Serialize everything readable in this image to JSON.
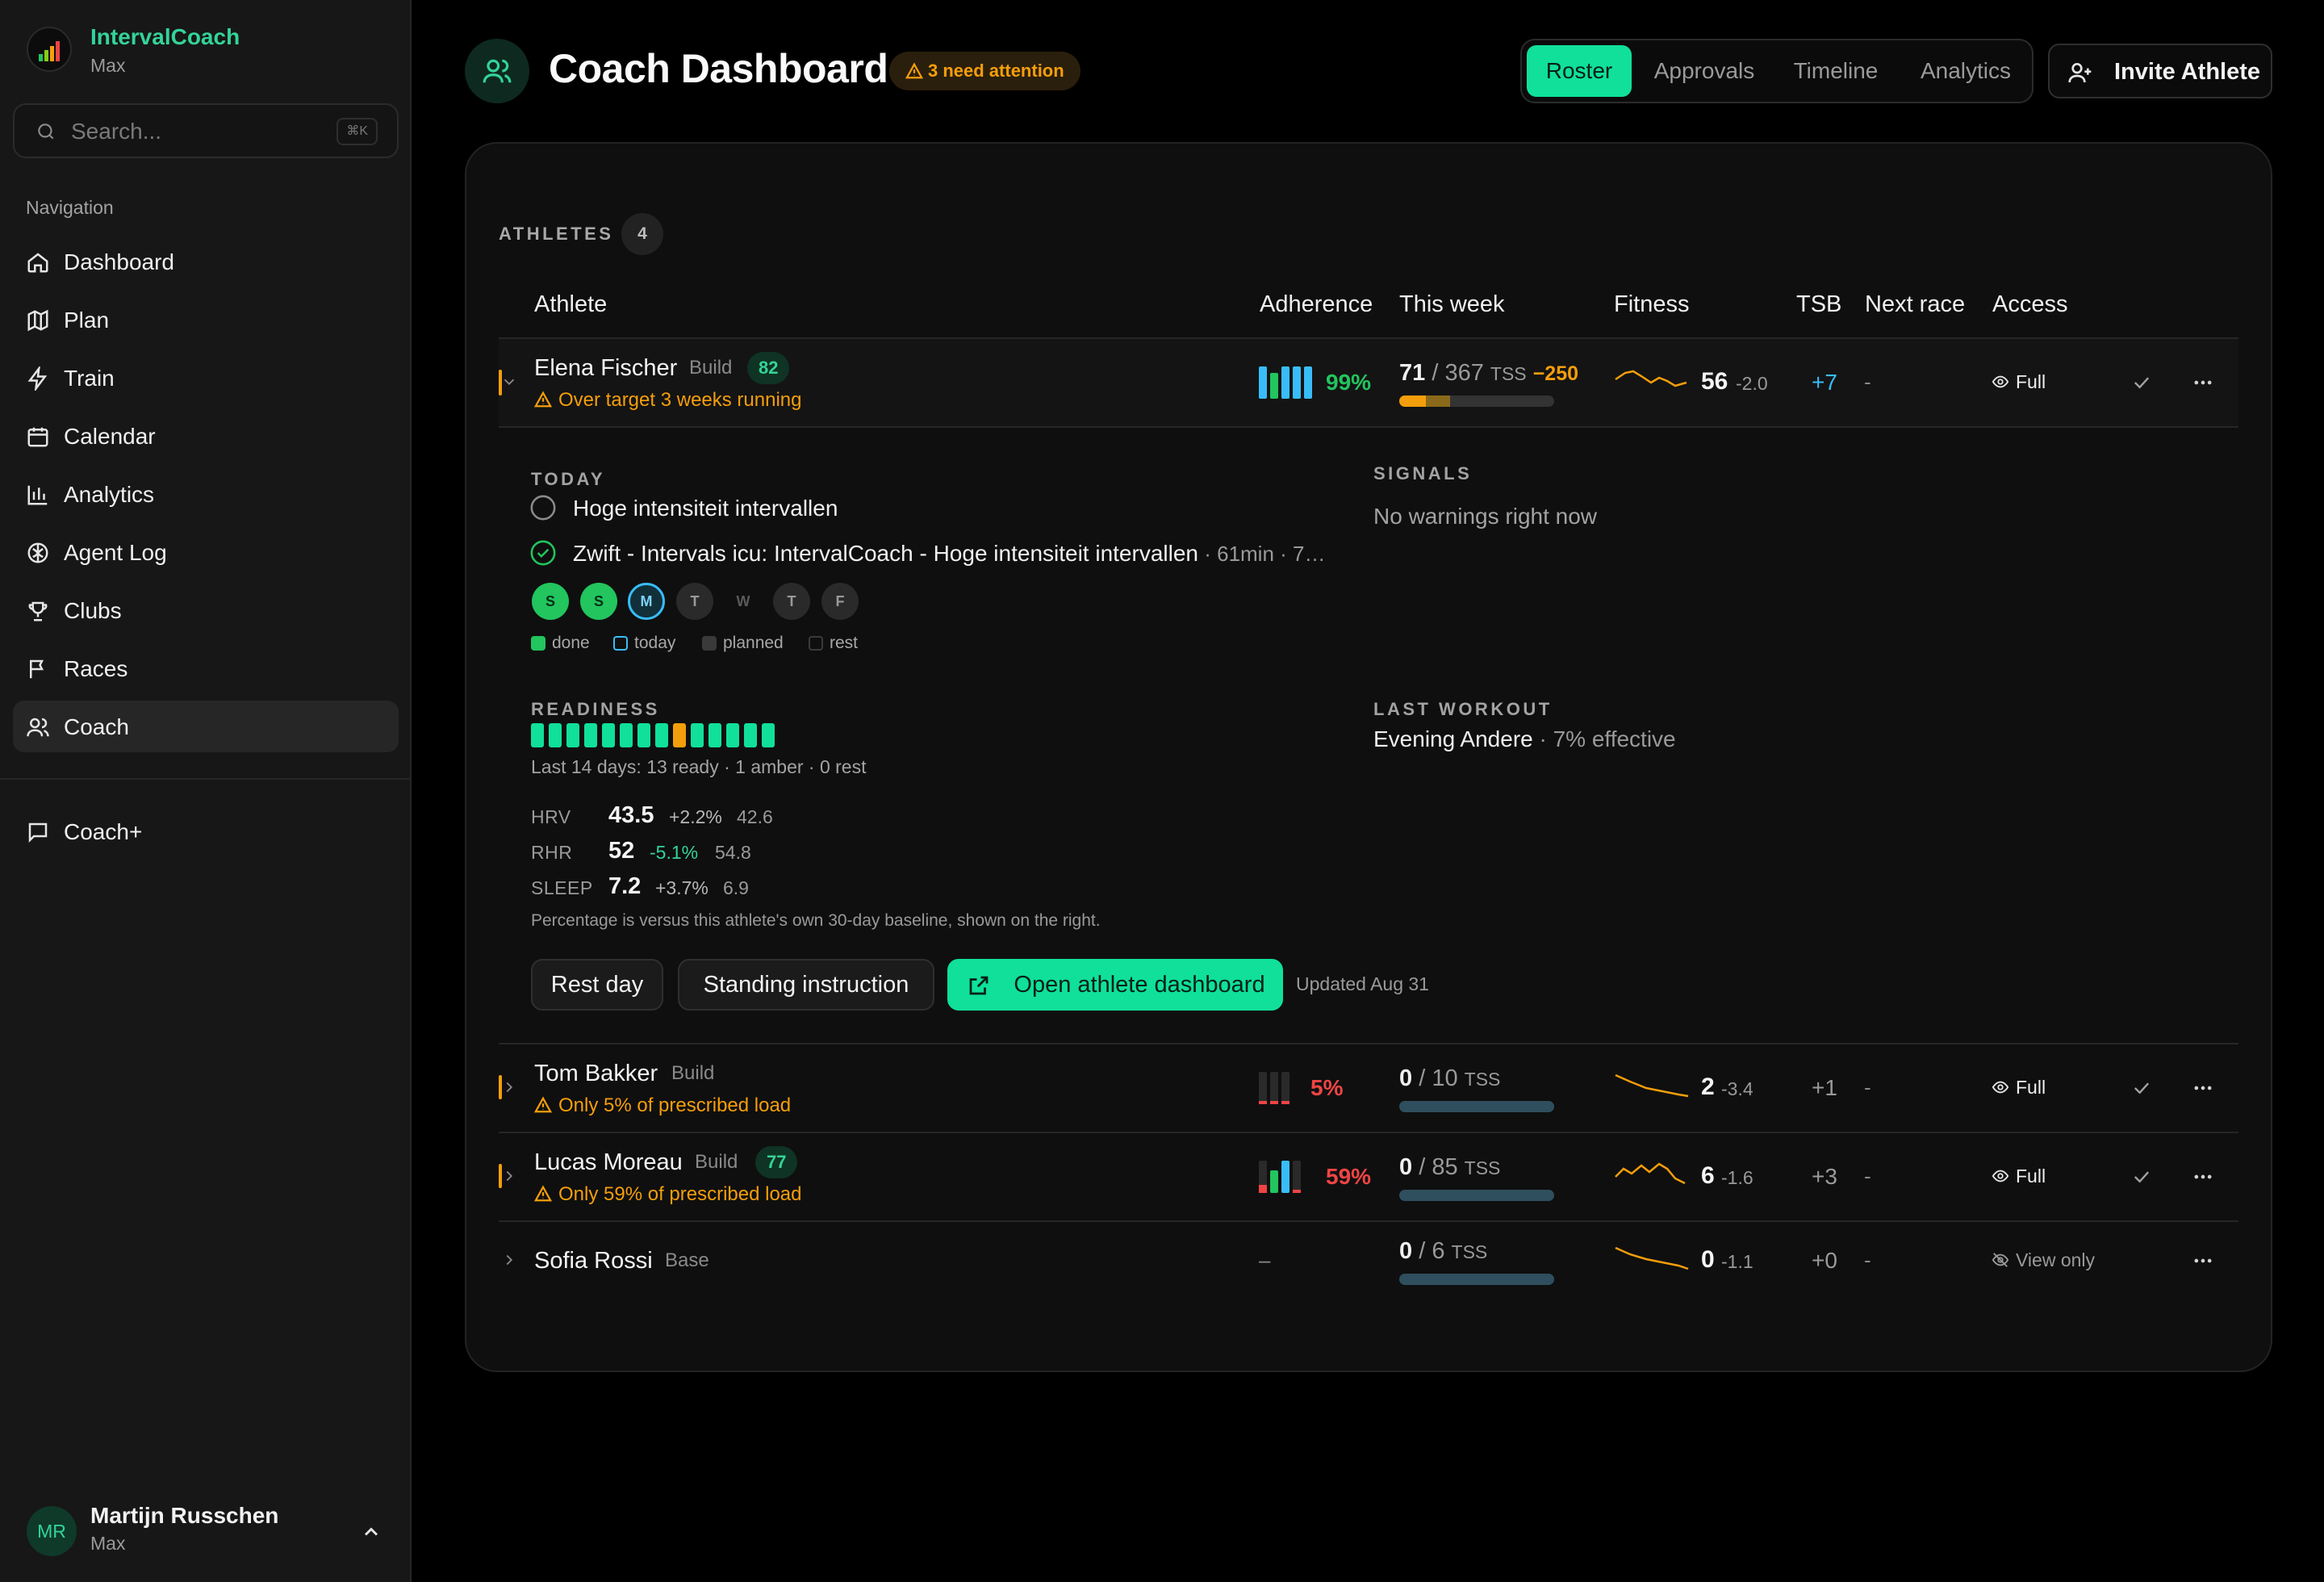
{
  "brand": {
    "name": "IntervalCoach",
    "sub": "Max"
  },
  "search": {
    "placeholder": "Search...",
    "shortcut": "⌘K"
  },
  "nav": {
    "heading": "Navigation",
    "items": [
      {
        "label": "Dashboard",
        "icon": "home-icon"
      },
      {
        "label": "Plan",
        "icon": "map-icon"
      },
      {
        "label": "Train",
        "icon": "bolt-icon"
      },
      {
        "label": "Calendar",
        "icon": "calendar-icon"
      },
      {
        "label": "Analytics",
        "icon": "bar-chart-icon"
      },
      {
        "label": "Agent Log",
        "icon": "brain-icon"
      },
      {
        "label": "Clubs",
        "icon": "trophy-icon"
      },
      {
        "label": "Races",
        "icon": "flag-icon"
      },
      {
        "label": "Coach",
        "icon": "users-icon",
        "active": true
      }
    ],
    "extra": {
      "label": "Coach+",
      "icon": "message-icon"
    }
  },
  "user": {
    "initials": "MR",
    "name": "Martijn Russchen",
    "sub": "Max"
  },
  "header": {
    "title": "Coach Dashboard",
    "attention": "3 need attention",
    "tabs": [
      "Roster",
      "Approvals",
      "Timeline",
      "Analytics"
    ],
    "active_tab": "Roster",
    "invite": "Invite Athlete"
  },
  "roster": {
    "label": "ATHLETES",
    "count": "4",
    "columns": [
      "Athlete",
      "Adherence",
      "This week",
      "Fitness",
      "TSB",
      "Next race",
      "Access"
    ],
    "athletes": [
      {
        "name": "Elena Fischer",
        "phase": "Build",
        "score": "82",
        "warning": "Over target 3 weeks running",
        "adherence": "99%",
        "adherence_fraction": 0.99,
        "tss_done": "71",
        "tss_sep": "/",
        "tss_target": "367",
        "tss_unit": "TSS",
        "tss_delta": "−250",
        "fitness": "56",
        "fitness_delta": "-2.0",
        "tsb": "+7",
        "next_race": "-",
        "access": "Full"
      },
      {
        "name": "Tom Bakker",
        "phase": "Build",
        "warning": "Only 5% of prescribed load",
        "adherence": "5%",
        "adherence_fraction": 0.05,
        "tss_done": "0",
        "tss_sep": "/",
        "tss_target": "10",
        "tss_unit": "TSS",
        "fitness": "2",
        "fitness_delta": "-3.4",
        "tsb": "+1",
        "next_race": "-",
        "access": "Full"
      },
      {
        "name": "Lucas Moreau",
        "phase": "Build",
        "score": "77",
        "warning": "Only 59% of prescribed load",
        "adherence": "59%",
        "adherence_fraction": 0.59,
        "tss_done": "0",
        "tss_sep": "/",
        "tss_target": "85",
        "tss_unit": "TSS",
        "fitness": "6",
        "fitness_delta": "-1.6",
        "tsb": "+3",
        "next_race": "-",
        "access": "Full"
      },
      {
        "name": "Sofia Rossi",
        "phase": "Base",
        "adherence": "–",
        "tss_done": "0",
        "tss_sep": "/",
        "tss_target": "6",
        "tss_unit": "TSS",
        "fitness": "0",
        "fitness_delta": "-1.1",
        "tsb": "+0",
        "next_race": "-",
        "access": "View only"
      }
    ]
  },
  "detail": {
    "today_label": "TODAY",
    "planned_workout": "Hoge intensiteit intervallen",
    "completed_workout": "Zwift - Intervals icu: IntervalCoach - Hoge intensiteit intervallen",
    "completed_meta": " · 61min · 7…",
    "week_days": [
      "S",
      "S",
      "M",
      "T",
      "W",
      "T",
      "F"
    ],
    "legend": [
      "done",
      "today",
      "planned",
      "rest"
    ],
    "signals_label": "SIGNALS",
    "signals_text": "No warnings right now",
    "readiness_label": "READINESS",
    "readiness_summary": "Last 14 days: 13 ready · 1 amber · 0 rest",
    "metrics": [
      {
        "key": "HRV",
        "value": "43.5",
        "delta": "+2.2%",
        "baseline": "42.6",
        "color": "#b8b8b8"
      },
      {
        "key": "RHR",
        "value": "52",
        "delta": "-5.1%",
        "baseline": "54.8",
        "color": "#34d399"
      },
      {
        "key": "SLEEP",
        "value": "7.2",
        "delta": "+3.7%",
        "baseline": "6.9",
        "color": "#b8b8b8"
      }
    ],
    "baseline_note": "Percentage is versus this athlete's own 30-day baseline, shown on the right.",
    "last_workout_label": "LAST WORKOUT",
    "last_workout_name": "Evening Andere",
    "last_workout_meta": " · 7% effective",
    "buttons": {
      "rest": "Rest day",
      "standing": "Standing instruction",
      "open": "Open athlete dashboard"
    },
    "updated": "Updated Aug 31"
  },
  "colors": {
    "accent": "#10e09a",
    "warning": "#f59e0b",
    "danger": "#ef4444",
    "info": "#38bdf8"
  }
}
